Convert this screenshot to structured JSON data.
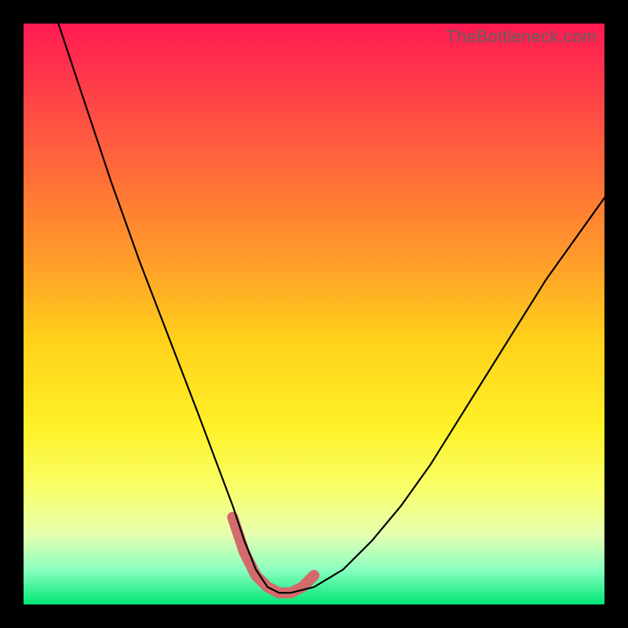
{
  "watermark": "TheBottleneck.com",
  "chart_data": {
    "type": "line",
    "title": "",
    "xlabel": "",
    "ylabel": "",
    "xlim": [
      0,
      100
    ],
    "ylim": [
      0,
      100
    ],
    "grid": false,
    "legend": null,
    "background": {
      "gradient": "vertical",
      "stops": [
        {
          "pos": 0,
          "color": "#ff1a52"
        },
        {
          "pos": 0.5,
          "color": "#ffd21a"
        },
        {
          "pos": 0.9,
          "color": "#e6ffb0"
        },
        {
          "pos": 1.0,
          "color": "#00e676"
        }
      ]
    },
    "series": [
      {
        "name": "bottleneck-curve",
        "color": "#000000",
        "x": [
          6,
          10,
          15,
          20,
          25,
          30,
          33,
          36,
          38,
          40,
          42,
          44,
          46,
          50,
          55,
          60,
          65,
          70,
          75,
          80,
          85,
          90,
          95,
          100
        ],
        "y": [
          100,
          88,
          73,
          59,
          46,
          33,
          25,
          17,
          11,
          6,
          3,
          2,
          2,
          3,
          6,
          11,
          17,
          24,
          32,
          40,
          48,
          56,
          63,
          70
        ]
      }
    ],
    "highlight": {
      "name": "optimal-zone",
      "color": "#d46a6a",
      "x": [
        36,
        38,
        40,
        42,
        44,
        46,
        48,
        50
      ],
      "y": [
        15,
        9,
        5,
        3,
        2,
        2,
        3,
        5
      ]
    }
  }
}
